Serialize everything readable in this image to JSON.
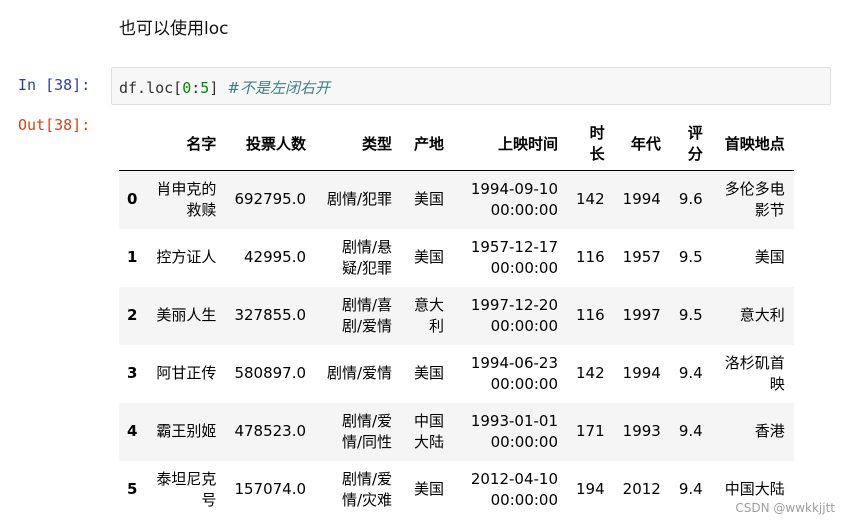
{
  "markdown_text": "也可以使用loc",
  "input_prompt": "In  [38]:",
  "output_prompt": "Out[38]:",
  "code": {
    "prefix": "df.loc[",
    "start": "0",
    "colon": ":",
    "end": "5",
    "suffix": "] ",
    "comment": "#不是左闭右开"
  },
  "table": {
    "columns": [
      "名字",
      "投票人数",
      "类型",
      "产地",
      "上映时间",
      "时长",
      "年代",
      "评分",
      "首映地点"
    ],
    "rows": [
      {
        "index": "0",
        "cells": [
          "肖申克的救赎",
          "692795.0",
          "剧情/犯罪",
          "美国",
          "1994-09-10 00:00:00",
          "142",
          "1994",
          "9.6",
          "多伦多电影节"
        ]
      },
      {
        "index": "1",
        "cells": [
          "控方证人",
          "42995.0",
          "剧情/悬疑/犯罪",
          "美国",
          "1957-12-17 00:00:00",
          "116",
          "1957",
          "9.5",
          "美国"
        ]
      },
      {
        "index": "2",
        "cells": [
          "美丽人生",
          "327855.0",
          "剧情/喜剧/爱情",
          "意大利",
          "1997-12-20 00:00:00",
          "116",
          "1997",
          "9.5",
          "意大利"
        ]
      },
      {
        "index": "3",
        "cells": [
          "阿甘正传",
          "580897.0",
          "剧情/爱情",
          "美国",
          "1994-06-23 00:00:00",
          "142",
          "1994",
          "9.4",
          "洛杉矶首映"
        ]
      },
      {
        "index": "4",
        "cells": [
          "霸王别姬",
          "478523.0",
          "剧情/爱情/同性",
          "中国大陆",
          "1993-01-01 00:00:00",
          "171",
          "1993",
          "9.4",
          "香港"
        ]
      },
      {
        "index": "5",
        "cells": [
          "泰坦尼克号",
          "157074.0",
          "剧情/爱情/灾难",
          "美国",
          "2012-04-10 00:00:00",
          "194",
          "2012",
          "9.4",
          "中国大陆"
        ]
      }
    ]
  },
  "watermark": "CSDN @wwkkjjtt"
}
